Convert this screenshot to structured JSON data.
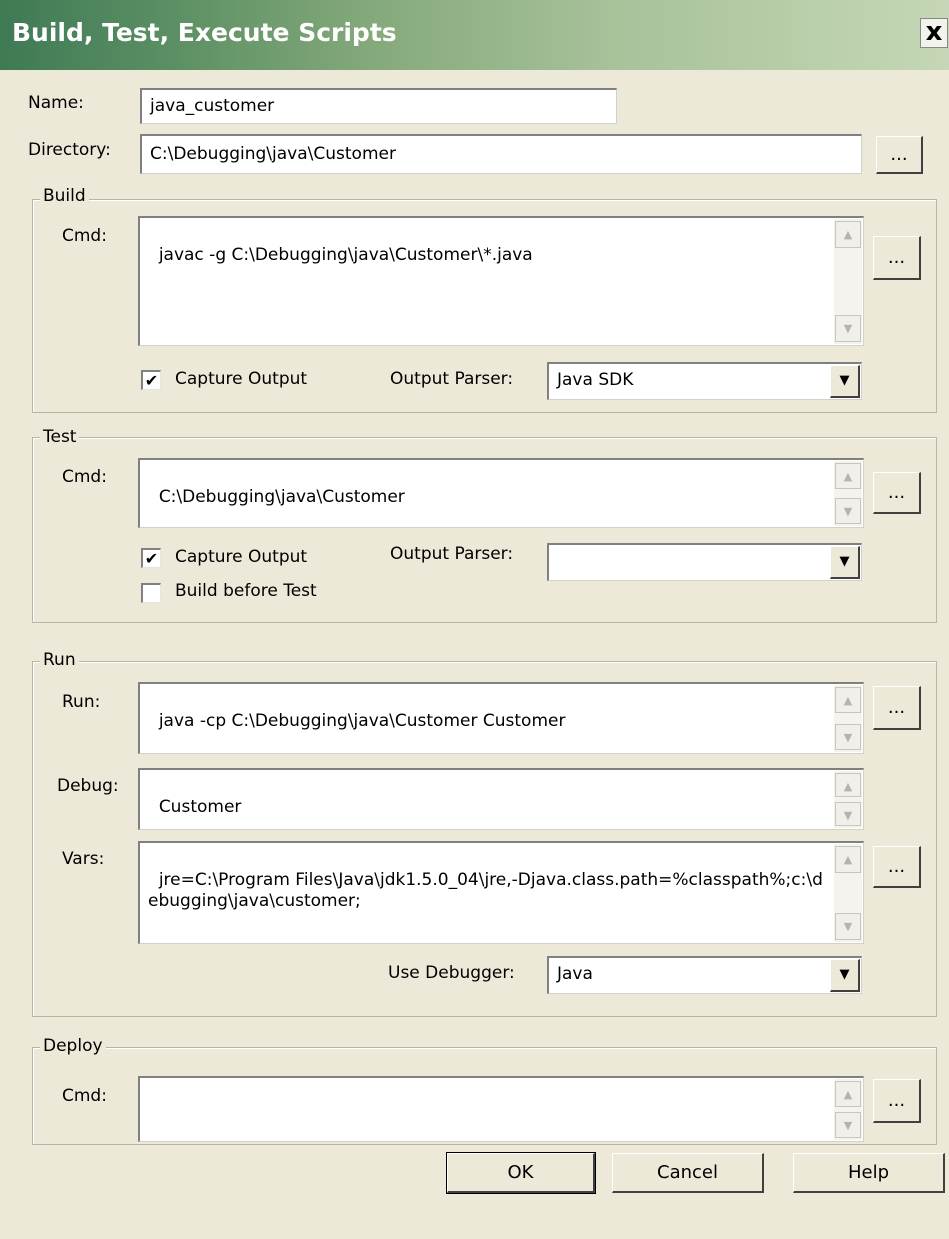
{
  "window": {
    "title": "Build, Test, Execute Scripts",
    "close_glyph": "x"
  },
  "name": {
    "label": "Name:",
    "value": "java_customer"
  },
  "directory": {
    "label": "Directory:",
    "value": "C:\\Debugging\\java\\Customer",
    "browse_label": "..."
  },
  "build": {
    "legend": "Build",
    "cmd_label": "Cmd:",
    "cmd_value": "javac -g C:\\Debugging\\java\\Customer\\*.java",
    "browse_label": "...",
    "capture_output": {
      "label": "Capture Output",
      "checked": true
    },
    "output_parser": {
      "label": "Output Parser:",
      "value": "Java SDK"
    }
  },
  "test": {
    "legend": "Test",
    "cmd_label": "Cmd:",
    "cmd_value": "C:\\Debugging\\java\\Customer",
    "browse_label": "...",
    "capture_output": {
      "label": "Capture Output",
      "checked": true
    },
    "output_parser": {
      "label": "Output Parser:",
      "value": ""
    },
    "build_before_test": {
      "label": "Build before Test",
      "checked": false
    }
  },
  "run": {
    "legend": "Run",
    "run_label": "Run:",
    "run_value": "java -cp C:\\Debugging\\java\\Customer Customer",
    "run_browse_label": "...",
    "debug_label": "Debug:",
    "debug_value": "Customer",
    "vars_label": "Vars:",
    "vars_value": "jre=C:\\Program Files\\Java\\jdk1.5.0_04\\jre,-Djava.class.path=%classpath%;c:\\debugging\\java\\customer;",
    "vars_browse_label": "...",
    "use_debugger": {
      "label": "Use Debugger:",
      "value": "Java"
    }
  },
  "deploy": {
    "legend": "Deploy",
    "cmd_label": "Cmd:",
    "cmd_value": "",
    "browse_label": "..."
  },
  "buttons": {
    "ok": "OK",
    "cancel": "Cancel",
    "help": "Help"
  },
  "icons": {
    "check": "✔",
    "scroll_up": "▲",
    "scroll_down": "▼",
    "combo_down": "▼"
  }
}
